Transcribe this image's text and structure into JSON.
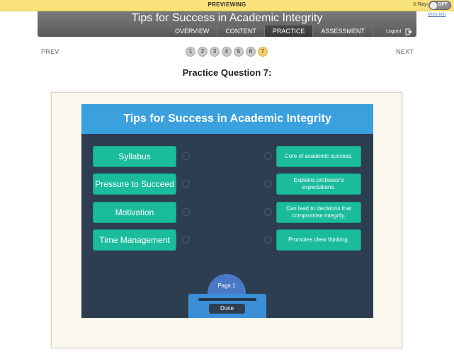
{
  "preview_bar": {
    "label": "PREVIEWING",
    "xray_label": "X-Ray:",
    "xray_state": "OFF",
    "more_info": "More Info"
  },
  "header": {
    "title": "Tips for Success in Academic Integrity",
    "tabs": [
      {
        "label": "OVERVIEW"
      },
      {
        "label": "CONTENT"
      },
      {
        "label": "PRACTICE",
        "active": true
      },
      {
        "label": "ASSESSMENT"
      }
    ],
    "logout": "Logout"
  },
  "pager": {
    "prev": "PREV",
    "next": "NEXT",
    "pages": [
      "1",
      "2",
      "3",
      "4",
      "5",
      "6",
      "7"
    ],
    "current": "7"
  },
  "question_title": "Practice Question 7:",
  "slide": {
    "title": "Tips for Success in Academic Integrity",
    "left_items": [
      "Syllabus",
      "Pressure to Succeed",
      "Motivation",
      "Time Management"
    ],
    "right_items": [
      "Core of academic success.",
      "Explains professor's expectations.",
      "Can lead to decisions that compromise integrity.",
      "Promotes clear thinking."
    ],
    "page_label": "Page 1",
    "done_label": "Done"
  },
  "colors": {
    "slide_bg": "#2d3e50",
    "slide_header": "#3ba0de",
    "item": "#1abc9c",
    "preview_bar": "#f9e27a"
  }
}
